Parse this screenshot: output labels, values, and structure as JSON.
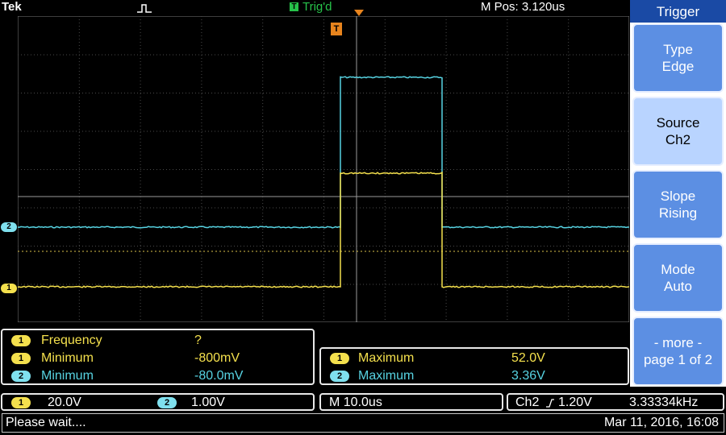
{
  "header": {
    "brand": "Tek",
    "acquire_icon": "pulse-icon",
    "trigger_badge": "T",
    "trigger_status": "Trig'd",
    "horizontal_position": "M Pos: 3.120us"
  },
  "screen": {
    "trigger_point_marker": "T",
    "channel_markers": [
      {
        "label": "2",
        "color": "#7fe0ee"
      },
      {
        "label": "1",
        "color": "#f4e04d"
      }
    ]
  },
  "trigger_menu": {
    "title": "Trigger",
    "buttons": [
      {
        "line1": "Type",
        "line2": "Edge"
      },
      {
        "line1": "Source",
        "line2": "Ch2"
      },
      {
        "line1": "Slope",
        "line2": "Rising"
      },
      {
        "line1": "Mode",
        "line2": "Auto"
      },
      {
        "line1": "- more -",
        "line2": "page 1 of 2"
      }
    ]
  },
  "measurements": {
    "left": [
      {
        "channel": "1",
        "label": "Frequency",
        "value": "?"
      },
      {
        "channel": "1",
        "label": "Minimum",
        "value": "-800mV"
      },
      {
        "channel": "2",
        "label": "Minimum",
        "value": "-80.0mV"
      }
    ],
    "right": [
      {
        "channel": "1",
        "label": "Maximum",
        "value": "52.0V"
      },
      {
        "channel": "2",
        "label": "Maximum",
        "value": "3.36V"
      }
    ]
  },
  "status": {
    "ch1_badge": "1",
    "ch1_scale": "20.0V",
    "ch2_badge": "2",
    "ch2_scale": "1.00V",
    "timebase": "M 10.0us",
    "trigger_source": "Ch2",
    "trigger_slope_icon": "rising-edge-icon",
    "trigger_level": "1.20V",
    "trigger_frequency": "3.33334kHz",
    "message": "Please wait....",
    "datetime": "Mar 11, 2016, 16:08"
  },
  "colors": {
    "ch1": "#f4e04d",
    "ch2": "#57d3e2",
    "trigger_ok": "#27c34a",
    "marker_orange": "#e8841d",
    "menu_title": "#1a4aa5",
    "menu_button": "#5c8fe3"
  }
}
